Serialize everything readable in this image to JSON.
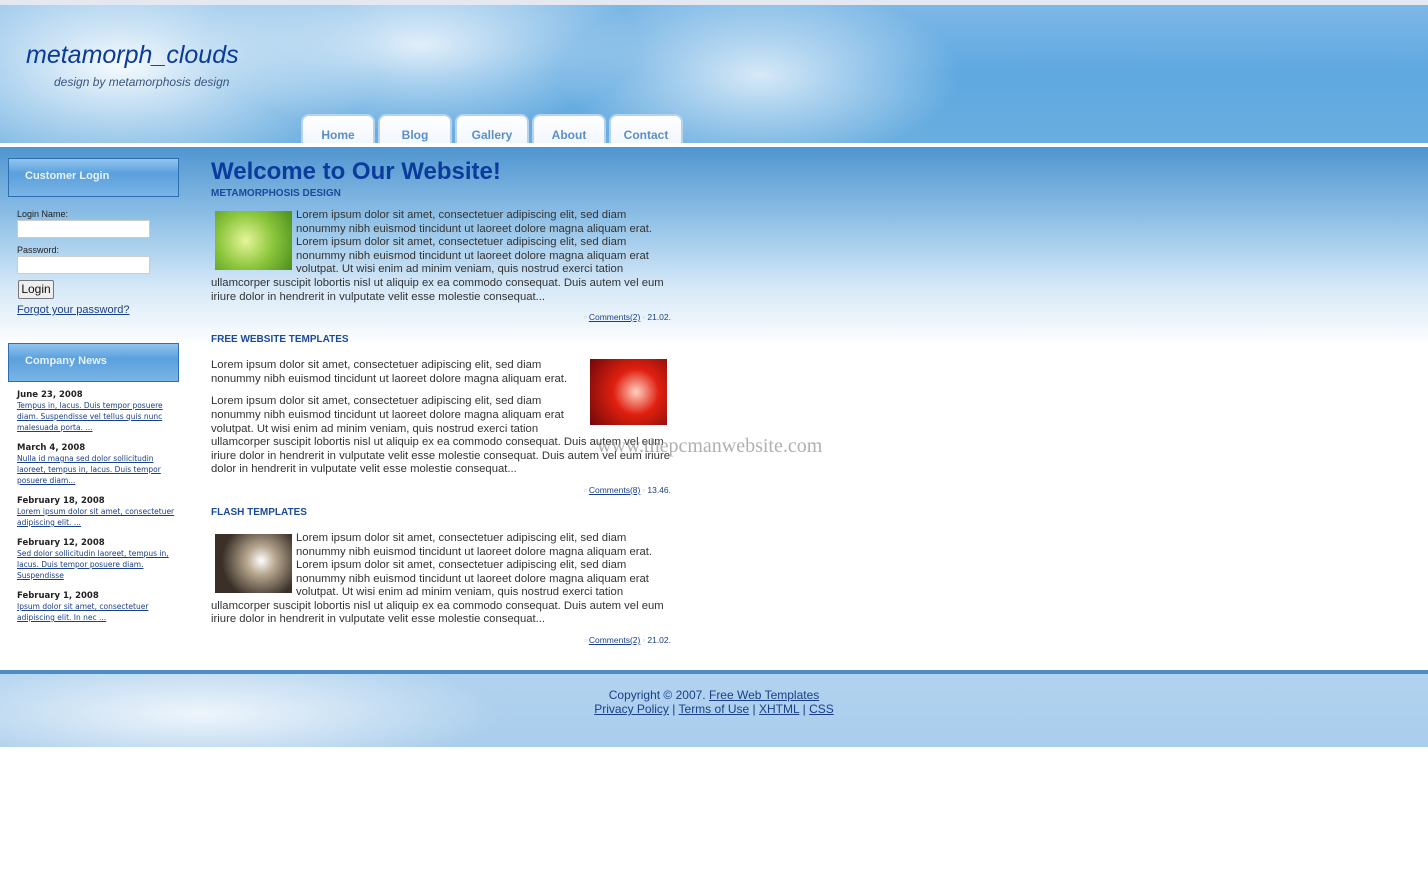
{
  "header": {
    "brand": "metamorph_clouds",
    "tagline": "design by metamorphosis design"
  },
  "nav": [
    "Home",
    "Blog",
    "Gallery",
    "About",
    "Contact"
  ],
  "sidebar": {
    "login": {
      "title": "Customer Login",
      "name_label": "Login Name:",
      "name_value": "",
      "password_label": "Password:",
      "password_value": "",
      "button": "Login",
      "forgot": "Forgot your password?"
    },
    "news": {
      "title": "Company News",
      "items": [
        {
          "date": "June 23, 2008",
          "text": "Tempus in, lacus. Duis tempor posuere diam. Suspendisse vel tellus quis nunc malesuada porta. ..."
        },
        {
          "date": "March 4, 2008",
          "text": "Nulla id magna sed dolor sollicitudin laoreet, tempus in, lacus. Duis tempor posuere diam..."
        },
        {
          "date": "February 18, 2008",
          "text": "Lorem ipsum dolor sit amet, consectetuer adipiscing elit. ..."
        },
        {
          "date": "February 12, 2008",
          "text": "Sed dolor sollicitudin laoreet, tempus in, lacus. Duis tempor posuere diam. Suspendisse"
        },
        {
          "date": "February 1, 2008",
          "text": "Ipsum dolor sit amet, consectetuer adipiscing elit. In nec ..."
        }
      ]
    }
  },
  "main": {
    "title": "Welcome to Our Website!",
    "sections": [
      {
        "heading": "METAMORPHOSIS DESIGN",
        "paragraphs": [
          "Lorem ipsum dolor sit amet, consectetuer adipiscing elit, sed diam nonummy nibh euismod tincidunt ut laoreet dolore magna aliquam erat. Lorem ipsum dolor sit amet, consectetuer adipiscing elit, sed diam nonummy nibh euismod tincidunt ut laoreet dolore magna aliquam erat volutpat. Ut wisi enim ad minim veniam, quis nostrud exerci tation ullamcorper suscipit lobortis nisl ut aliquip ex ea commodo consequat. Duis autem vel eum iriure dolor in hendrerit in vulputate velit esse molestie consequat..."
        ],
        "comments": "Comments(2)",
        "time": "21.02."
      },
      {
        "heading": "FREE WEBSITE TEMPLATES",
        "paragraphs": [
          "Lorem ipsum dolor sit amet, consectetuer adipiscing elit, sed diam nonummy nibh euismod tincidunt ut laoreet dolore magna aliquam erat.",
          "Lorem ipsum dolor sit amet, consectetuer adipiscing elit, sed diam nonummy nibh euismod tincidunt ut laoreet dolore magna aliquam erat volutpat. Ut wisi enim ad minim veniam, quis nostrud exerci tation ullamcorper suscipit lobortis nisl ut aliquip ex ea commodo consequat. Duis autem vel eum iriure dolor in hendrerit in vulputate velit esse molestie consequat. Duis autem vel eum iriure dolor in hendrerit in vulputate velit esse molestie consequat..."
        ],
        "comments": "Comments(8)",
        "time": "13.46."
      },
      {
        "heading": "FLASH TEMPLATES",
        "paragraphs": [
          "Lorem ipsum dolor sit amet, consectetuer adipiscing elit, sed diam nonummy nibh euismod tincidunt ut laoreet dolore magna aliquam erat. Lorem ipsum dolor sit amet, consectetuer adipiscing elit, sed diam nonummy nibh euismod tincidunt ut laoreet dolore magna aliquam erat volutpat. Ut wisi enim ad minim veniam, quis nostrud exerci tation ullamcorper suscipit lobortis nisl ut aliquip ex ea commodo consequat. Duis autem vel eum iriure dolor in hendrerit in vulputate velit esse molestie consequat..."
        ],
        "comments": "Comments(2)",
        "time": "21.02."
      }
    ]
  },
  "watermark": "www.thepcmanwebsite.com",
  "footer": {
    "copyright": "Copyright © 2007.",
    "free_templates": "Free Web Templates",
    "links": [
      "Privacy Policy",
      "Terms of Use",
      "XHTML",
      "CSS"
    ],
    "separator": "|"
  }
}
